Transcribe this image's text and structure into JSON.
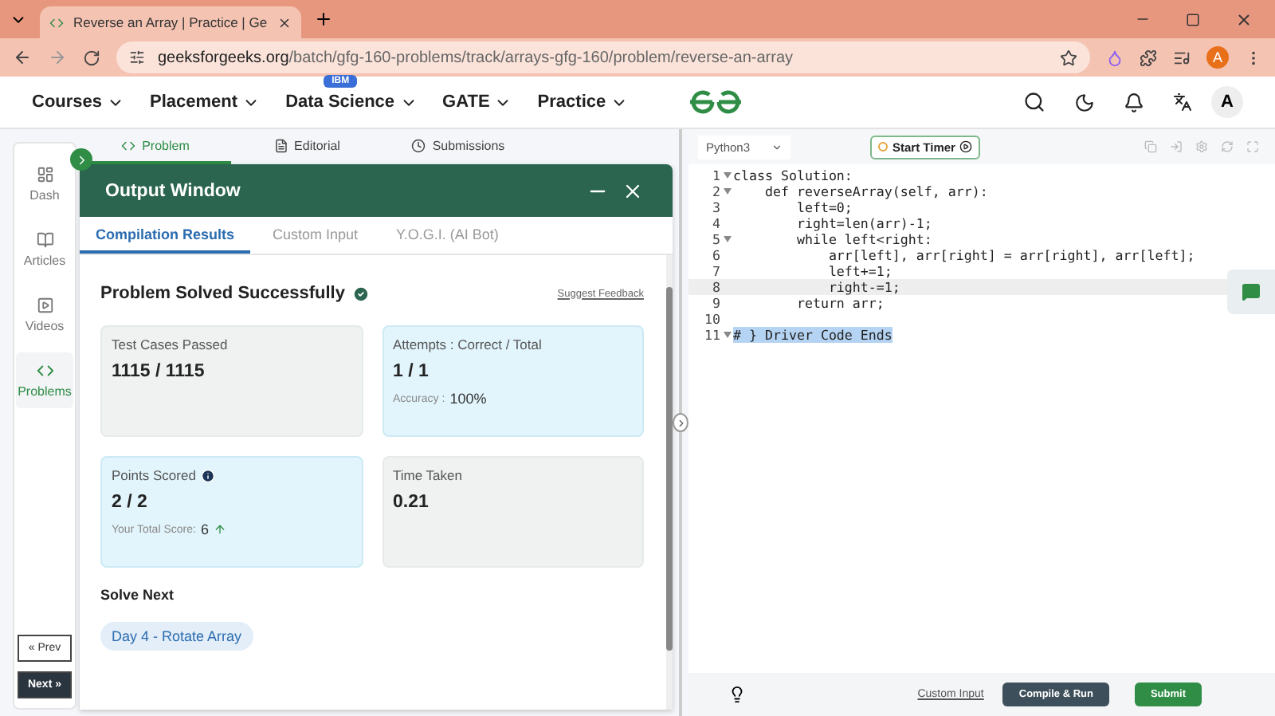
{
  "browser": {
    "tab_title": "Reverse an Array | Practice | Ge",
    "url_domain": "geeksforgeeks.org",
    "url_path": "/batch/gfg-160-problems/track/arrays-gfg-160/problem/reverse-an-array",
    "profile_initial": "A"
  },
  "header": {
    "nav": [
      {
        "label": "Courses"
      },
      {
        "label": "Placement"
      },
      {
        "label": "Data Science",
        "badge": "IBM"
      },
      {
        "label": "GATE"
      },
      {
        "label": "Practice"
      }
    ],
    "avatar": "A"
  },
  "sidebar": {
    "items": [
      {
        "label": "Dash",
        "kind": "dash",
        "selected": false
      },
      {
        "label": "Articles",
        "kind": "articles",
        "selected": false
      },
      {
        "label": "Videos",
        "kind": "videos",
        "selected": false
      },
      {
        "label": "Problems",
        "kind": "problems",
        "selected": true
      }
    ],
    "prev": "« Prev",
    "next": "Next »"
  },
  "problem_tabs": [
    {
      "label": "Problem",
      "kind": "code",
      "selected": true
    },
    {
      "label": "Editorial",
      "kind": "doc",
      "selected": false
    },
    {
      "label": "Submissions",
      "kind": "clock",
      "selected": false
    }
  ],
  "output_window": {
    "title": "Output Window",
    "tabs": [
      {
        "label": "Compilation Results",
        "selected": true
      },
      {
        "label": "Custom Input",
        "selected": false
      },
      {
        "label": "Y.O.G.I. (AI Bot)",
        "selected": false
      }
    ],
    "status": "Problem Solved Successfully",
    "feedback": "Suggest Feedback",
    "cards": [
      {
        "title": "Test Cases Passed",
        "value": "1115 / 1115",
        "highlighted": false
      },
      {
        "title": "Attempts : Correct / Total",
        "value": "1 / 1",
        "note_label": "Accuracy :",
        "note_value": "100%",
        "highlighted": true
      },
      {
        "title": "Points Scored",
        "value": "2 / 2",
        "note_label": "Your Total Score:",
        "note_value": "6",
        "info": true,
        "rising": true,
        "highlighted": true
      },
      {
        "title": "Time Taken",
        "value": "0.21",
        "highlighted": false
      }
    ],
    "solve_next": {
      "heading": "Solve Next",
      "items": [
        "Day 4 - Rotate Array"
      ]
    }
  },
  "editor": {
    "language": "Python3",
    "timer": "Start Timer",
    "lines": [
      {
        "number": "1",
        "code": "class Solution:",
        "foldable": true,
        "active": false,
        "selected": false
      },
      {
        "number": "2",
        "code": "    def reverseArray(self, arr):",
        "foldable": true,
        "active": false,
        "selected": false
      },
      {
        "number": "3",
        "code": "        left=0;",
        "foldable": false,
        "active": false,
        "selected": false
      },
      {
        "number": "4",
        "code": "        right=len(arr)-1;",
        "foldable": false,
        "active": false,
        "selected": false
      },
      {
        "number": "5",
        "code": "        while left<right:",
        "foldable": true,
        "active": false,
        "selected": false
      },
      {
        "number": "6",
        "code": "            arr[left], arr[right] = arr[right], arr[left];",
        "foldable": false,
        "active": false,
        "selected": false
      },
      {
        "number": "7",
        "code": "            left+=1;",
        "foldable": false,
        "active": false,
        "selected": false
      },
      {
        "number": "8",
        "code": "            right-=1;",
        "foldable": false,
        "active": true,
        "selected": false
      },
      {
        "number": "9",
        "code": "        return arr;",
        "foldable": false,
        "active": false,
        "selected": false
      },
      {
        "number": "10",
        "foldable": false,
        "active": false,
        "selected": false
      },
      {
        "number": "11",
        "code": "# } Driver Code Ends",
        "foldable": true,
        "active": false,
        "selected": true
      }
    ],
    "footer": {
      "custom_input": "Custom Input",
      "compile": "Compile & Run",
      "submit": "Submit"
    }
  }
}
